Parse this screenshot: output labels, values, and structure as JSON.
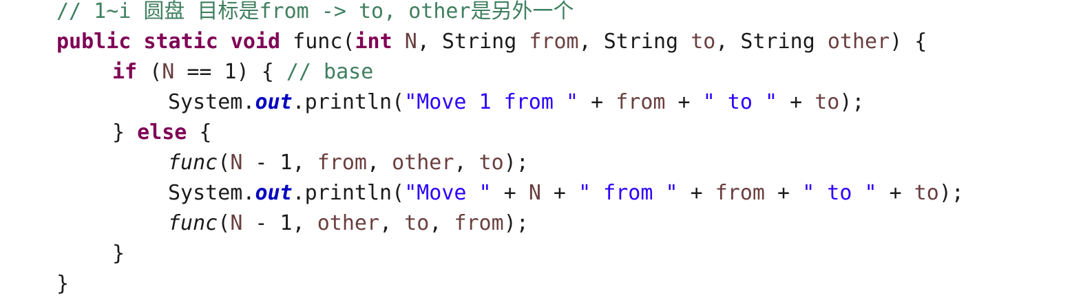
{
  "editor": {
    "language": "java",
    "colors": {
      "background": "#ffffff",
      "keyword": "#7f0055",
      "comment": "#3f7f5f",
      "string": "#2a00ff",
      "local_variable": "#6a3e3e",
      "static_field": "#0000c0",
      "plain": "#1b1b1b"
    },
    "lines": [
      {
        "tokens": [
          {
            "type": "cm",
            "text": "// 1~i 圆盘 目标是from -> to, other是另外一个"
          }
        ]
      },
      {
        "tokens": [
          {
            "type": "kw",
            "text": "public"
          },
          {
            "type": "pl",
            "text": " "
          },
          {
            "type": "kw",
            "text": "static"
          },
          {
            "type": "pl",
            "text": " "
          },
          {
            "type": "kw",
            "text": "void"
          },
          {
            "type": "pl",
            "text": " func("
          },
          {
            "type": "kw",
            "text": "int"
          },
          {
            "type": "pl",
            "text": " "
          },
          {
            "type": "var",
            "text": "N"
          },
          {
            "type": "pl",
            "text": ", String "
          },
          {
            "type": "var",
            "text": "from"
          },
          {
            "type": "pl",
            "text": ", String "
          },
          {
            "type": "var",
            "text": "to"
          },
          {
            "type": "pl",
            "text": ", String "
          },
          {
            "type": "var",
            "text": "other"
          },
          {
            "type": "pl",
            "text": ") {"
          }
        ]
      },
      {
        "tokens": [
          {
            "type": "kw",
            "text": "if"
          },
          {
            "type": "pl",
            "text": " ("
          },
          {
            "type": "var",
            "text": "N"
          },
          {
            "type": "pl",
            "text": " == 1) { "
          },
          {
            "type": "cm",
            "text": "// base"
          }
        ]
      },
      {
        "tokens": [
          {
            "type": "pl",
            "text": "System."
          },
          {
            "type": "fld",
            "text": "out"
          },
          {
            "type": "pl",
            "text": ".println("
          },
          {
            "type": "str",
            "text": "\"Move 1 from \""
          },
          {
            "type": "pl",
            "text": " + "
          },
          {
            "type": "var",
            "text": "from"
          },
          {
            "type": "pl",
            "text": " + "
          },
          {
            "type": "str",
            "text": "\" to \""
          },
          {
            "type": "pl",
            "text": " + "
          },
          {
            "type": "var",
            "text": "to"
          },
          {
            "type": "pl",
            "text": ");"
          }
        ]
      },
      {
        "tokens": [
          {
            "type": "pl",
            "text": "} "
          },
          {
            "type": "kw",
            "text": "else"
          },
          {
            "type": "pl",
            "text": " {"
          }
        ]
      },
      {
        "tokens": [
          {
            "type": "smi",
            "text": "func"
          },
          {
            "type": "pl",
            "text": "("
          },
          {
            "type": "var",
            "text": "N"
          },
          {
            "type": "pl",
            "text": " - 1, "
          },
          {
            "type": "var",
            "text": "from"
          },
          {
            "type": "pl",
            "text": ", "
          },
          {
            "type": "var",
            "text": "other"
          },
          {
            "type": "pl",
            "text": ", "
          },
          {
            "type": "var",
            "text": "to"
          },
          {
            "type": "pl",
            "text": ");"
          }
        ]
      },
      {
        "tokens": [
          {
            "type": "pl",
            "text": "System."
          },
          {
            "type": "fld",
            "text": "out"
          },
          {
            "type": "pl",
            "text": ".println("
          },
          {
            "type": "str",
            "text": "\"Move \""
          },
          {
            "type": "pl",
            "text": " + "
          },
          {
            "type": "var",
            "text": "N"
          },
          {
            "type": "pl",
            "text": " + "
          },
          {
            "type": "str",
            "text": "\" from \""
          },
          {
            "type": "pl",
            "text": " + "
          },
          {
            "type": "var",
            "text": "from"
          },
          {
            "type": "pl",
            "text": " + "
          },
          {
            "type": "str",
            "text": "\" to \""
          },
          {
            "type": "pl",
            "text": " + "
          },
          {
            "type": "var",
            "text": "to"
          },
          {
            "type": "pl",
            "text": ");"
          }
        ]
      },
      {
        "tokens": [
          {
            "type": "smi",
            "text": "func"
          },
          {
            "type": "pl",
            "text": "("
          },
          {
            "type": "var",
            "text": "N"
          },
          {
            "type": "pl",
            "text": " - 1, "
          },
          {
            "type": "var",
            "text": "other"
          },
          {
            "type": "pl",
            "text": ", "
          },
          {
            "type": "var",
            "text": "to"
          },
          {
            "type": "pl",
            "text": ", "
          },
          {
            "type": "var",
            "text": "from"
          },
          {
            "type": "pl",
            "text": ");"
          }
        ]
      },
      {
        "tokens": [
          {
            "type": "pl",
            "text": "}"
          }
        ]
      },
      {
        "tokens": [
          {
            "type": "pl",
            "text": "}"
          }
        ]
      }
    ]
  }
}
